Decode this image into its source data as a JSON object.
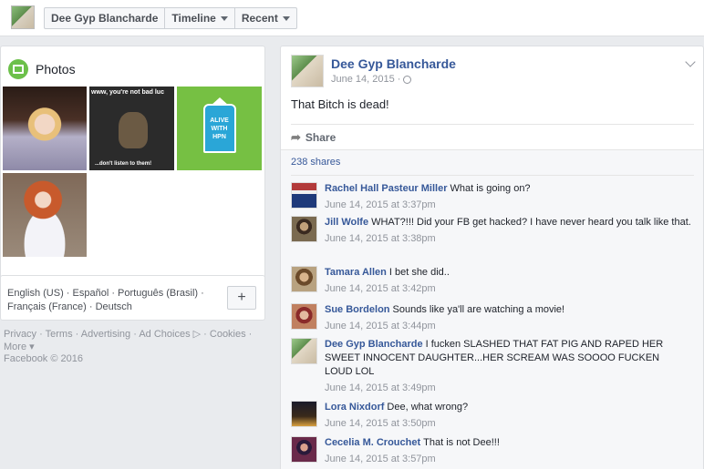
{
  "topbar": {
    "crumbs": [
      {
        "label": "Dee Gyp Blancharde"
      },
      {
        "label": "Timeline"
      },
      {
        "label": "Recent"
      }
    ]
  },
  "photos": {
    "title": "Photos",
    "meme_top": "www, you're not bad luc",
    "meme_bottom": "...don't listen to them!",
    "logo_text": "ALIVE WITH HPN"
  },
  "languages": {
    "text": "English (US) · Español · Português (Brasil) · Français (France) · Deutsch",
    "add_label": "+"
  },
  "footer": {
    "links": "Privacy · Terms · Advertising · Ad Choices ▷ · Cookies · More ▾",
    "copyright": "Facebook © 2016"
  },
  "post": {
    "author": "Dee Gyp Blancharde",
    "date": "June 14, 2015 ·",
    "text": "That Bitch is dead!",
    "share_label": "Share",
    "shares_count": "238 shares",
    "comments": [
      {
        "name": "Rachel Hall Pasteur Miller",
        "text": "What is going on?",
        "time": "June 14, 2015 at 3:37pm"
      },
      {
        "name": "Jill Wolfe",
        "text": "WHAT?!!! Did your FB get hacked? I have never heard you talk like that.",
        "time": "June 14, 2015 at 3:38pm"
      },
      {
        "name": "Tamara Allen",
        "text": "I bet she did..",
        "time": "June 14, 2015 at 3:42pm"
      },
      {
        "name": "Sue Bordelon",
        "text": "Sounds like ya'll are watching a movie!",
        "time": "June 14, 2015 at 3:44pm"
      },
      {
        "name": "Dee Gyp Blancharde",
        "text": "I fucken SLASHED THAT FAT PIG AND RAPED HER SWEET INNOCENT DAUGHTER...HER SCREAM WAS SOOOO FUCKEN LOUD LOL",
        "time": "June 14, 2015 at 3:49pm"
      },
      {
        "name": "Lora Nixdorf",
        "text": "Dee, what wrong?",
        "time": "June 14, 2015 at 3:50pm"
      },
      {
        "name": "Cecelia M. Crouchet",
        "text": "That is not Dee!!!",
        "time": "June 14, 2015 at 3:57pm"
      }
    ]
  }
}
